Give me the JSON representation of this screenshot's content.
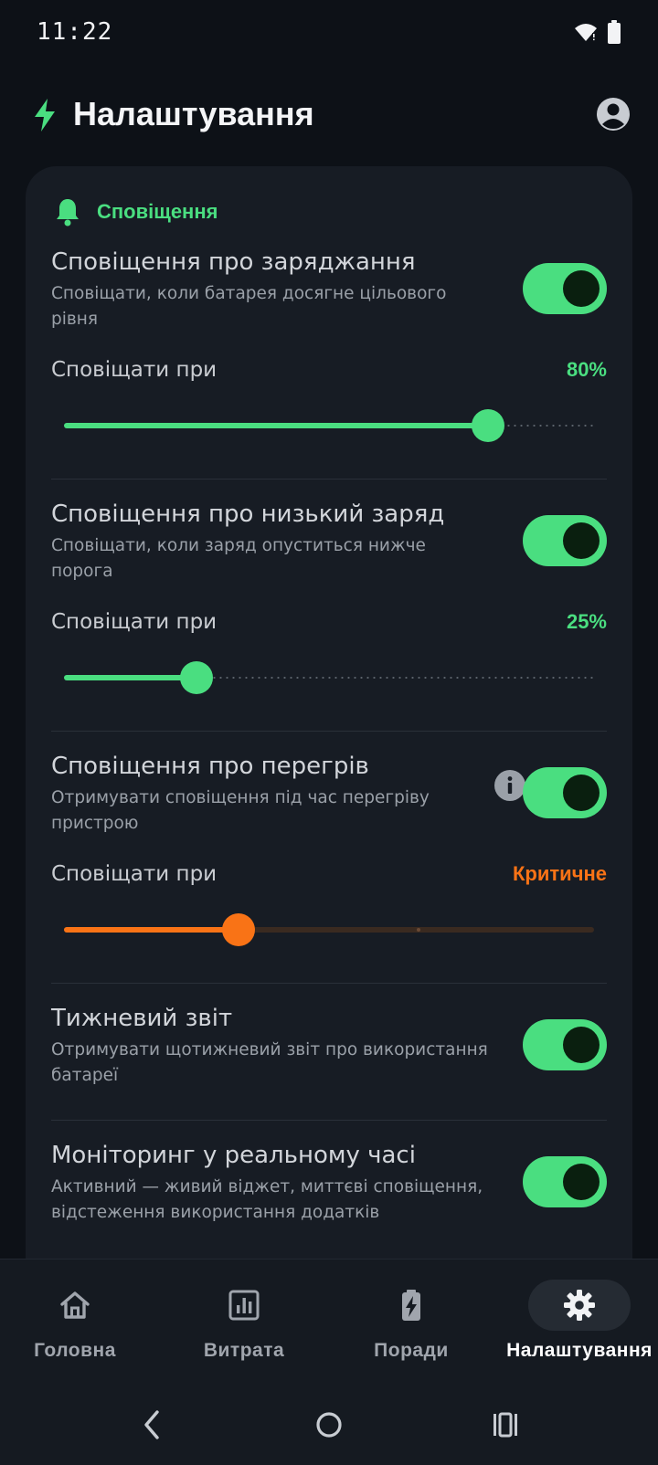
{
  "status": {
    "time": "11:22",
    "icons": [
      "wifi-icon",
      "battery-icon"
    ]
  },
  "header": {
    "title": "Налаштування",
    "icon": "bolt-icon",
    "profile_icon": "account-icon"
  },
  "colors": {
    "accent": "#4ade80",
    "warning": "#f97316",
    "card": "#171c24",
    "background": "#0d1117"
  },
  "section": {
    "label": "Сповіщення",
    "icon": "bell-icon"
  },
  "settings": [
    {
      "title": "Сповіщення про заряджання",
      "desc": "Сповіщати, коли батарея досягне цільового рівня",
      "enabled": true,
      "threshold_label": "Сповіщати при",
      "threshold_value": "80%",
      "slider_fraction": 0.8
    },
    {
      "title": "Сповіщення про низький заряд",
      "desc": "Сповіщати, коли заряд опуститься нижче порога",
      "enabled": true,
      "threshold_label": "Сповіщати при",
      "threshold_value": "25%",
      "slider_fraction": 0.25
    },
    {
      "title": "Сповіщення про перегрів",
      "desc": "Отримувати сповіщення під час перегріву пристрою",
      "enabled": true,
      "info_icon": "info-icon",
      "threshold_label": "Сповіщати при",
      "threshold_value": "Критичне",
      "slider_fraction": 0.33
    },
    {
      "title": "Тижневий звіт",
      "desc": "Отримувати щотижневий звіт про використання батареї",
      "enabled": true
    },
    {
      "title": "Моніторинг у реальному часі",
      "desc": "Активний — живий віджет, миттєві сповіщення, відстеження використання додатків",
      "enabled": true
    }
  ],
  "nav": {
    "items": [
      {
        "label": "Головна",
        "icon": "home-icon",
        "active": false
      },
      {
        "label": "Витрата",
        "icon": "chart-icon",
        "active": false
      },
      {
        "label": "Поради",
        "icon": "battery-charging-icon",
        "active": false
      },
      {
        "label": "Налаштування",
        "icon": "settings-gear-icon",
        "active": true
      }
    ]
  },
  "system_nav": [
    "back-icon",
    "home-circle-icon",
    "recents-icon"
  ]
}
